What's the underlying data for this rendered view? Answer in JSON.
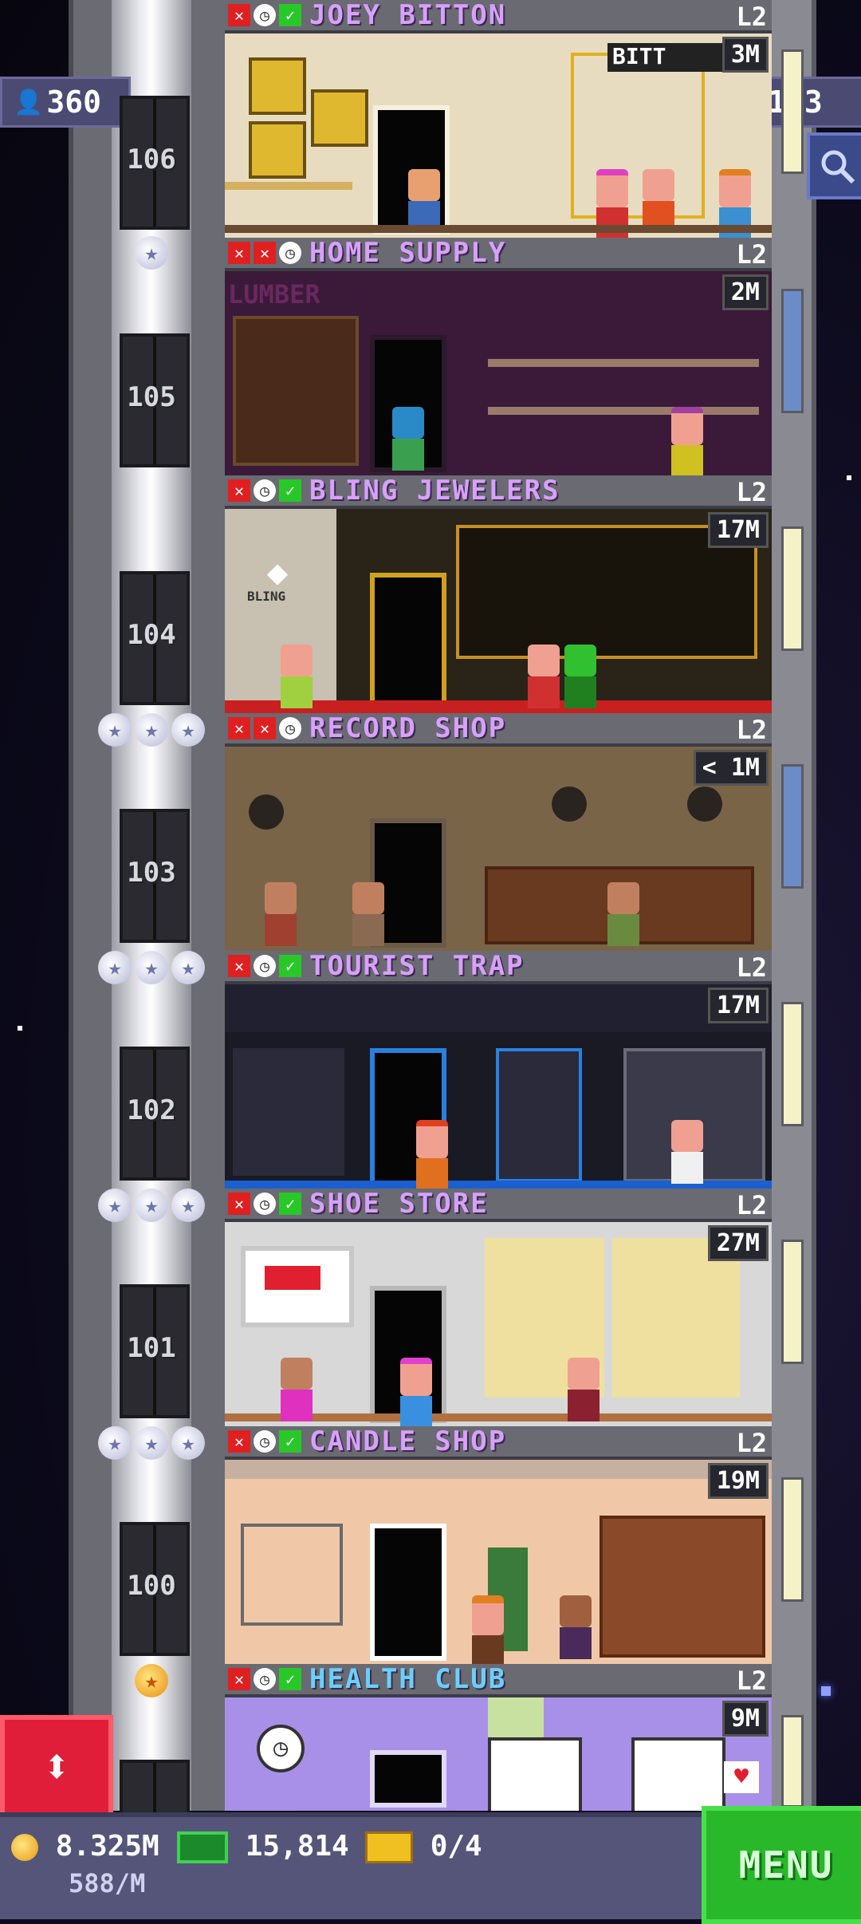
{
  "hud": {
    "population": "360",
    "floors": "123"
  },
  "floors": [
    {
      "num": "106",
      "name": "JOEY BITTON",
      "level": "L2",
      "income": "3M",
      "status": [
        "x",
        "clock",
        "ok"
      ],
      "sign": "BITT"
    },
    {
      "num": "105",
      "name": "HOME SUPPLY",
      "level": "L2",
      "income": "2M",
      "status": [
        "x",
        "x",
        "clock"
      ],
      "sign": "LUMBER"
    },
    {
      "num": "104",
      "name": "BLING JEWELERS",
      "level": "L2",
      "income": "17M",
      "status": [
        "x",
        "clock",
        "ok"
      ],
      "sign": "BLING"
    },
    {
      "num": "103",
      "name": "RECORD SHOP",
      "level": "L2",
      "income": "< 1M",
      "status": [
        "x",
        "x",
        "clock"
      ]
    },
    {
      "num": "102",
      "name": "TOURIST TRAP",
      "level": "L2",
      "income": "17M",
      "status": [
        "x",
        "clock",
        "ok"
      ]
    },
    {
      "num": "101",
      "name": "SHOE STORE",
      "level": "L2",
      "income": "27M",
      "status": [
        "x",
        "clock",
        "ok"
      ]
    },
    {
      "num": "100",
      "name": "CANDLE SHOP",
      "level": "L2",
      "income": "19M",
      "status": [
        "x",
        "clock",
        "ok"
      ]
    },
    {
      "num": "",
      "name": "HEALTH CLUB",
      "level": "L2",
      "income": "9M",
      "status": [
        "x",
        "clock",
        "ok"
      ]
    }
  ],
  "footer": {
    "coins": "8.325M",
    "rate": "588/M",
    "bux": "15,814",
    "tickets": "0/4",
    "menu_label": "MENU"
  },
  "colors": {
    "accent_green": "#28b82a",
    "shop_name": "#d8a0ff",
    "elevator_button": "#e01e3a"
  }
}
